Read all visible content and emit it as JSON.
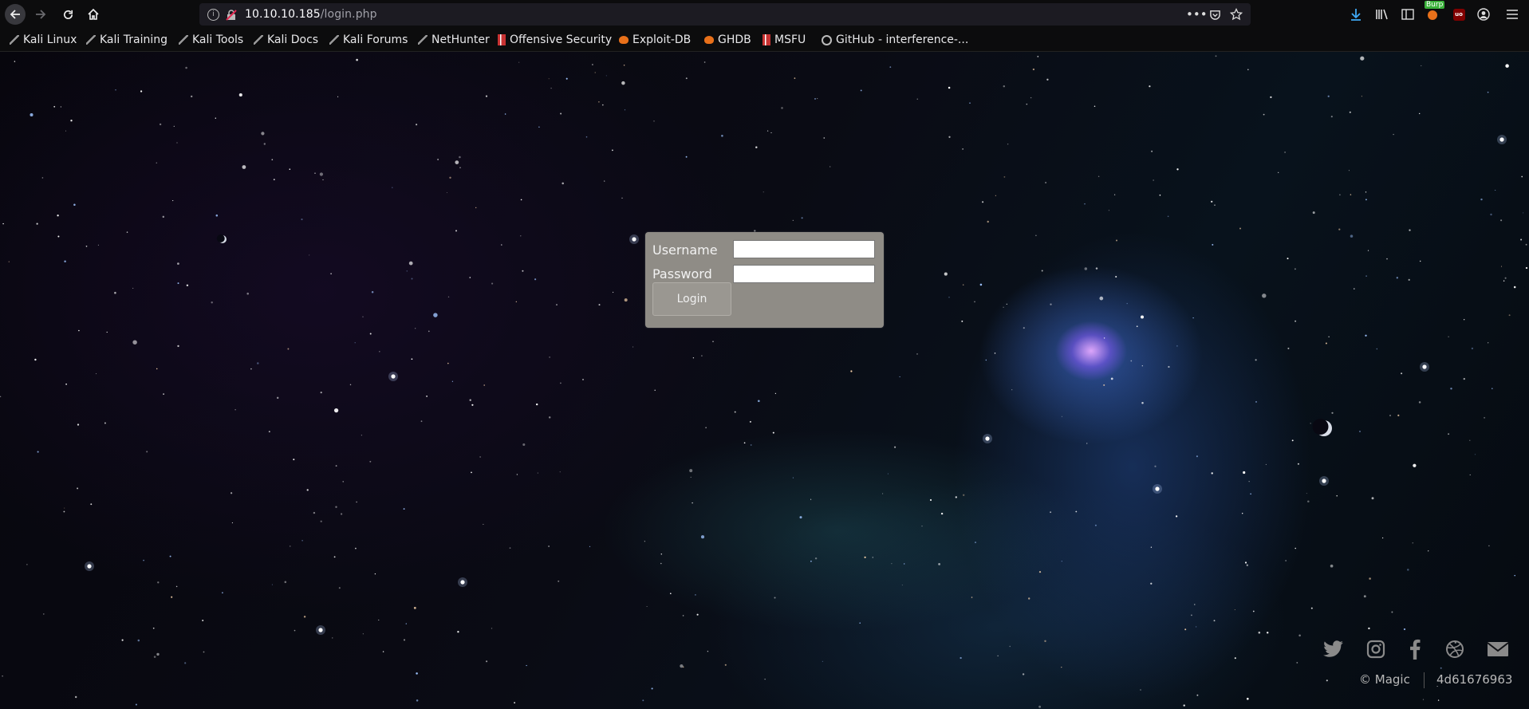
{
  "browser": {
    "url_host": "10.10.10.185",
    "url_path": "/login.php",
    "burp_label": "Burp",
    "ublock_label": "uo"
  },
  "bookmarks": [
    {
      "label": "Kali Linux",
      "icon": "kali-icon"
    },
    {
      "label": "Kali Training",
      "icon": "kali-icon"
    },
    {
      "label": "Kali Tools",
      "icon": "kali-icon"
    },
    {
      "label": "Kali Docs",
      "icon": "kali-icon"
    },
    {
      "label": "Kali Forums",
      "icon": "kali-icon"
    },
    {
      "label": "NetHunter",
      "icon": "kali-icon"
    },
    {
      "label": "Offensive Security",
      "icon": "offsec-icon"
    },
    {
      "label": "Exploit-DB",
      "icon": "exploit-db-icon"
    },
    {
      "label": "GHDB",
      "icon": "exploit-db-icon"
    },
    {
      "label": "MSFU",
      "icon": "offsec-icon"
    },
    {
      "label": "GitHub - interference-...",
      "icon": "github-icon"
    }
  ],
  "login": {
    "username_label": "Username",
    "password_label": "Password",
    "username_value": "",
    "password_value": "",
    "button_label": "Login"
  },
  "footer": {
    "social_icons": [
      "twitter-icon",
      "instagram-icon",
      "facebook-icon",
      "dribbble-icon",
      "mail-icon"
    ],
    "copyright": "© Magic",
    "code": "4d61676963"
  },
  "colors": {
    "chrome_bg": "#0c0c0d",
    "urlbar_bg": "#1c1b22",
    "login_box_bg": "#8f8c86",
    "nebula_core": "#e6aaff"
  }
}
